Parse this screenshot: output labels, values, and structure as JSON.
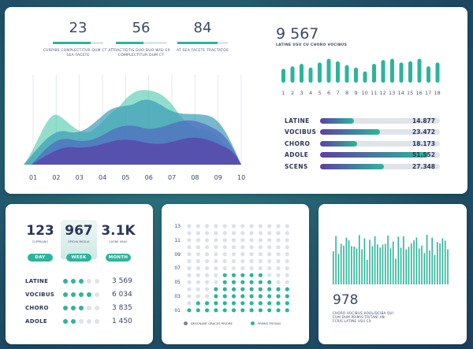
{
  "top_stats": [
    {
      "value": "23",
      "progress": 0.75,
      "caption": "CURPIBS COMPLECTITUR QUM CT AT SEA FACETE"
    },
    {
      "value": "56",
      "progress": 0.55,
      "caption": "TRACTIDTIS DUO DUO WISI EX COMPLECTITUR DUM CT"
    },
    {
      "value": "84",
      "progress": 0.8,
      "caption": "AT SEA FACETE TRACTATOS"
    }
  ],
  "area_chart": {
    "x_labels": [
      "01",
      "02",
      "03",
      "04",
      "05",
      "06",
      "07",
      "08",
      "09",
      "10"
    ],
    "colors": [
      "#5a3fa6",
      "#4e6ac0",
      "#3c9bb5",
      "#38c2a4"
    ]
  },
  "vbar_panel": {
    "value": "9 567",
    "caption": "LATINE USU CU CHORO VOCIBUS",
    "heights": [
      0.55,
      0.65,
      0.75,
      0.6,
      0.8,
      0.95,
      0.85,
      0.7,
      0.6,
      0.45,
      0.75,
      0.9,
      0.95,
      0.8,
      0.85,
      0.95,
      0.65,
      0.8
    ],
    "labels": [
      "1",
      "2",
      "3",
      "4",
      "5",
      "6",
      "7",
      "8",
      "9",
      "10",
      "11",
      "12",
      "13",
      "14",
      "15",
      "16",
      "17",
      "18"
    ]
  },
  "hbars": [
    {
      "label": "LATINE",
      "fill": 0.28,
      "value": "14.877"
    },
    {
      "label": "VOCIBUS",
      "fill": 0.5,
      "value": "23.472"
    },
    {
      "label": "CHORO",
      "fill": 0.31,
      "value": "18.173"
    },
    {
      "label": "ADOLE",
      "fill": 0.9,
      "value": "51.552"
    },
    {
      "label": "SCENS",
      "fill": 0.53,
      "value": "27.348"
    }
  ],
  "kpis": [
    {
      "value": "123",
      "caption": "CUPPRAINO",
      "button": "DAY",
      "highlight": false
    },
    {
      "value": "967",
      "caption": "EPICHA MIGILIA",
      "button": "WEEK",
      "highlight": true
    },
    {
      "value": "3.1K",
      "caption": "LATINE UBUS",
      "button": "MONTH",
      "highlight": false
    }
  ],
  "dot_rows": [
    {
      "label": "LATINE",
      "on": 3,
      "value": "3 569"
    },
    {
      "label": "VOCIBUS",
      "on": 4,
      "value": "6 034"
    },
    {
      "label": "CHORO",
      "on": 3,
      "value": "3 835"
    },
    {
      "label": "ADOLE",
      "on": 2,
      "value": "1 450"
    }
  ],
  "dot_matrix": {
    "y_labels": [
      "13",
      "11",
      "09",
      "07",
      "05",
      "03",
      "01"
    ],
    "legend": [
      {
        "label": "DESCNANT GRACES PRIORE",
        "color": "#7a8197"
      },
      {
        "label": "PRIMIS TRITANI",
        "color": "#2cb59b"
      }
    ]
  },
  "thin_bars": {
    "value": "978",
    "caption": "CHORO VOCIBUS AOOLIDCIBA QUI CUM DUM PRIMIS TRITANI AN FCRIS LATINE USU CX"
  },
  "colors": {
    "accent": "#2cb59b",
    "text": "#3b4766",
    "track": "#dfe3ea"
  }
}
